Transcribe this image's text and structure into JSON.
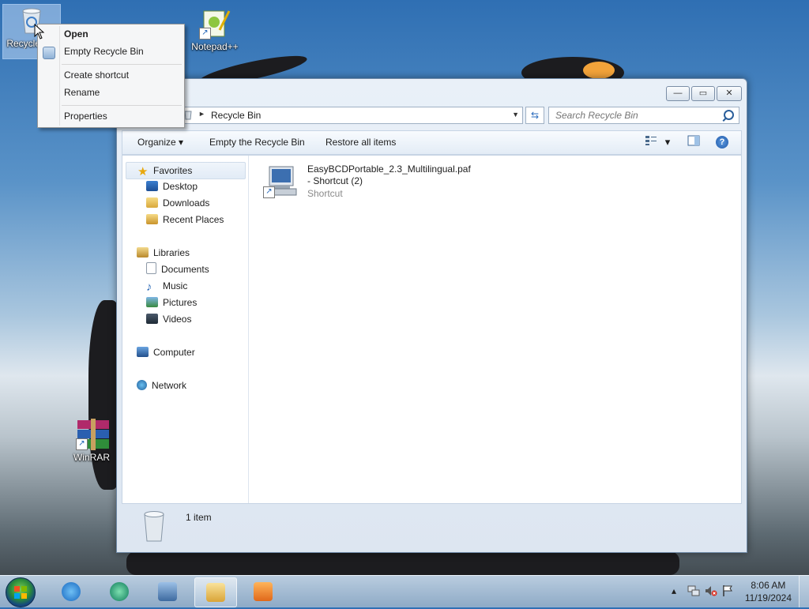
{
  "desktop": {
    "icons": [
      {
        "label": "Recycle Bin"
      },
      {
        "label": "Notepad++"
      },
      {
        "label": "WinRAR"
      }
    ]
  },
  "context_menu": {
    "items": [
      "Open",
      "Empty Recycle Bin",
      "Create shortcut",
      "Rename",
      "Properties"
    ]
  },
  "window": {
    "controls": {
      "minimize": "—",
      "maximize": "▭",
      "close": "✕"
    },
    "address": {
      "crumb_arrow": "►",
      "location": "Recycle Bin",
      "dropdown": "▼",
      "refresh": "⇆"
    },
    "search": {
      "placeholder": "Search Recycle Bin"
    },
    "toolbar": {
      "organize": "Organize ▾",
      "empty": "Empty the Recycle Bin",
      "restore": "Restore all items",
      "view_dropdown": "▾",
      "help": "?"
    },
    "nav": {
      "favorites": "Favorites",
      "desktop": "Desktop",
      "downloads": "Downloads",
      "recent_places": "Recent Places",
      "libraries": "Libraries",
      "documents": "Documents",
      "music": "Music",
      "pictures": "Pictures",
      "videos": "Videos",
      "computer": "Computer",
      "network": "Network"
    },
    "files": [
      {
        "name": "EasyBCDPortable_2.3_Multilingual.paf - Shortcut (2)",
        "type": "Shortcut"
      }
    ],
    "details": {
      "count": "1 item"
    }
  },
  "taskbar": {
    "tray": {
      "chevron": "▴",
      "time": "8:06 AM",
      "date": "11/19/2024"
    }
  },
  "colors": {
    "accent": "#2b5f9b",
    "selection": "#cfe2f6"
  }
}
